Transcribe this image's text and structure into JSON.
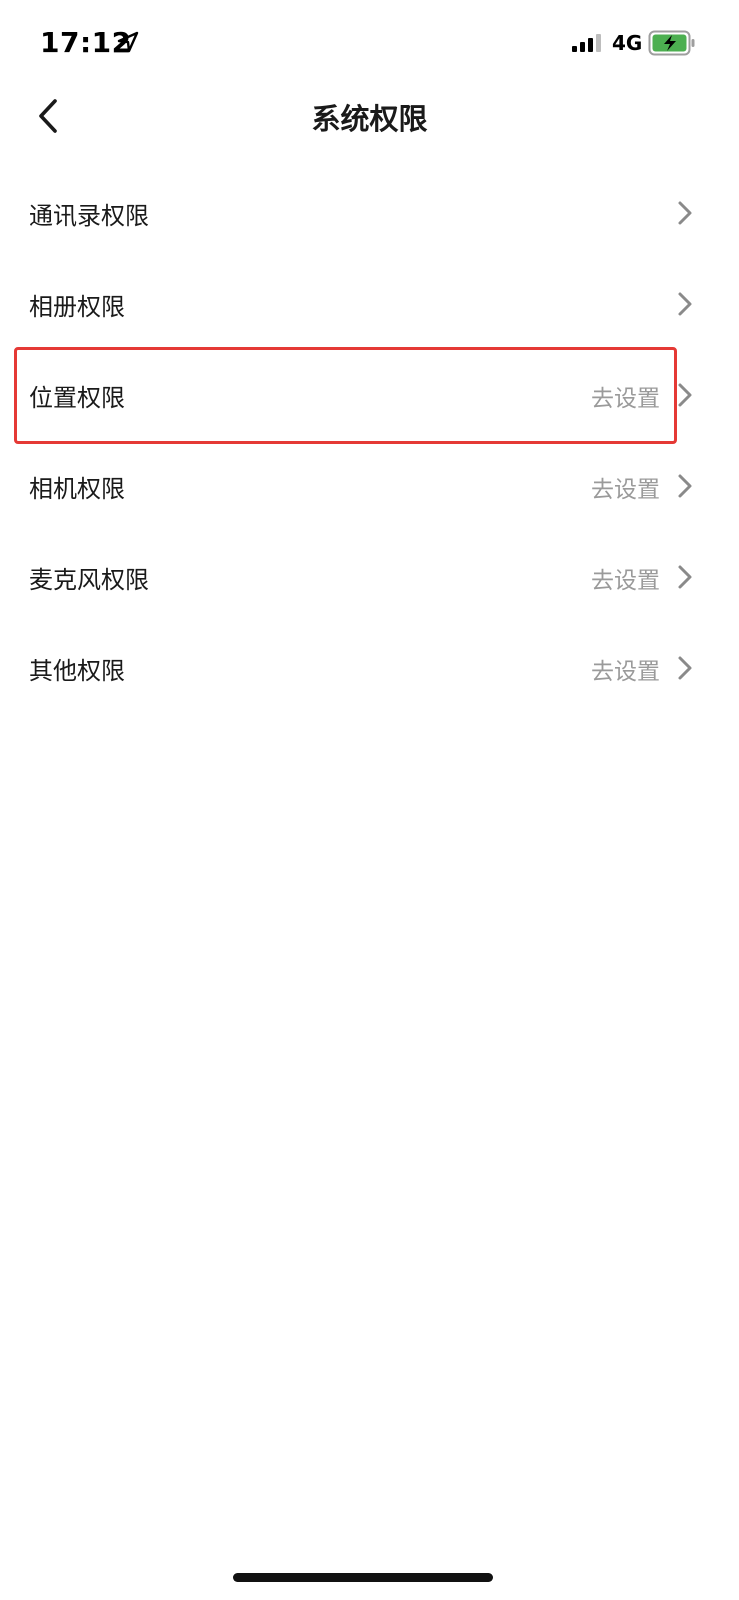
{
  "status_bar": {
    "time": "17:12",
    "network": "4G",
    "icons": [
      "location-arrow-icon",
      "cellular-signal-icon",
      "battery-charging-icon"
    ],
    "battery_color": "#4caf50"
  },
  "nav": {
    "title": "系统权限",
    "back_icon": "chevron-left-icon"
  },
  "permissions": [
    {
      "label": "通讯录权限",
      "action": ""
    },
    {
      "label": "相册权限",
      "action": ""
    },
    {
      "label": "位置权限",
      "action": "去设置"
    },
    {
      "label": "相机权限",
      "action": "去设置"
    },
    {
      "label": "麦克风权限",
      "action": "去设置"
    },
    {
      "label": "其他权限",
      "action": "去设置"
    }
  ],
  "colors": {
    "highlight": "#e53935",
    "action_text": "#9a9a9a",
    "chevron": "#8a8a8a"
  }
}
